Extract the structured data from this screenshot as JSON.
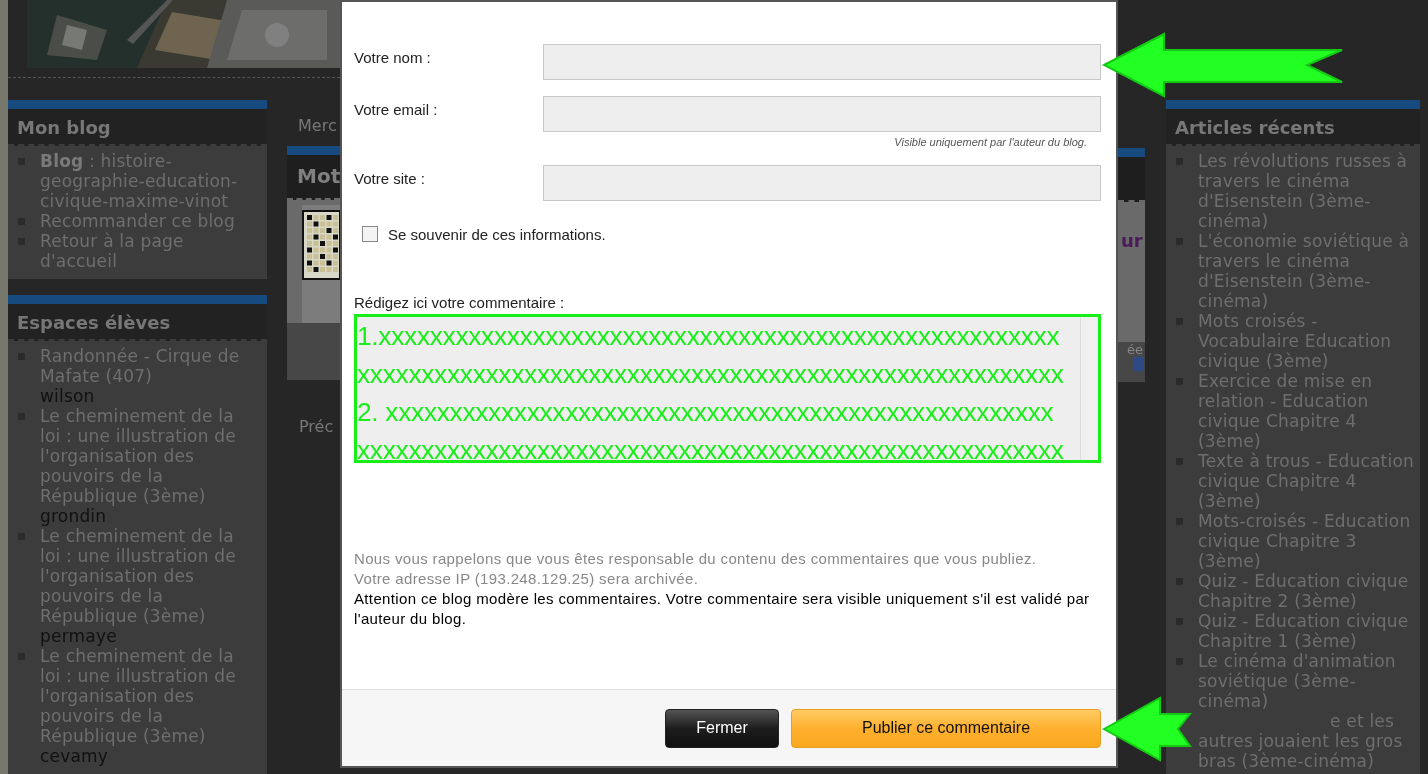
{
  "left_sidebar": [
    {
      "title": "Mon blog",
      "items": [
        {
          "text": "**Blog** : histoire-geographie-education-civique-maxime-vinot"
        },
        {
          "text": "Recommander ce blog"
        },
        {
          "text": "Retour à la page d'accueil"
        }
      ]
    },
    {
      "title": "Espaces élèves",
      "items": [
        {
          "text": "Randonnée - Cirque de Mafate (407)",
          "author": "wilson"
        },
        {
          "text": "Le cheminement de la loi : une illustration de l'organisation des pouvoirs de la République (3ème)",
          "author": "grondin"
        },
        {
          "text": "Le cheminement de la loi : une illustration de l'organisation des pouvoirs de la République (3ème)",
          "author": "permaye"
        },
        {
          "text": "Le cheminement de la loi : une illustration de l'organisation des pouvoirs de la République (3ème)",
          "author": "cevamy"
        }
      ]
    }
  ],
  "middle": {
    "date": "Merc",
    "post_title": "Mot",
    "nav": "Préc",
    "link": "ur",
    "note": "ée"
  },
  "dialog": {
    "fields": [
      {
        "label": "Votre nom :"
      },
      {
        "label": "Votre email :",
        "hint": "Visible uniquement par l'auteur du blog."
      },
      {
        "label": "Votre site :"
      }
    ],
    "remember": {
      "label": "Se souvenir de ces informations.",
      "checked": false
    },
    "comment": {
      "label": "Rédigez ici votre commentaire :",
      "value": "1.xxxxxxxxxxxxxxxxxxxxxxxxxxxxxxxxxxxxxxxxxxxxxxxxxxxxx\nxxxxxxxxxxxxxxxxxxxxxxxxxxxxxxxxxxxxxxxxxxxxxxxxxxxxxxx\n2. xxxxxxxxxxxxxxxxxxxxxxxxxxxxxxxxxxxxxxxxxxxxxxxxxxxx\nxxxxxxxxxxxxxxxxxxxxxxxxxxxxxxxxxxxxxxxxxxxxxxxxxxxxxxx"
    },
    "notices": [
      {
        "kind": "muted",
        "text": "Nous vous rappelons que vous êtes responsable du contenu des commentaires que vous publiez."
      },
      {
        "kind": "muted",
        "text": "Votre adresse IP (193.248.129.25) sera archivée."
      },
      {
        "kind": "strong",
        "text": "Attention ce blog modère les commentaires. Votre commentaire sera visible uniquement s'il est validé par l'auteur du blog."
      }
    ],
    "buttons": [
      {
        "label": "Fermer",
        "kind": "secondary"
      },
      {
        "label": "Publier ce commentaire",
        "kind": "primary"
      }
    ]
  },
  "right_sidebar": {
    "title": "Articles récents",
    "items": [
      {
        "kind": "full",
        "text": "Les révolutions russes à travers le cinéma d'Eisenstein (3ème-cinéma)"
      },
      {
        "kind": "full",
        "text": "L'économie soviétique à travers le cinéma d'Eisenstein (3ème-cinéma)"
      },
      {
        "kind": "full",
        "text": "Mots croisés - Vocabulaire Education civique (3ème)"
      },
      {
        "kind": "full",
        "text": "Exercice de mise en relation - Education civique Chapitre 4 (3ème)"
      },
      {
        "kind": "full",
        "text": "Texte à trous - Education civique Chapitre 4 (3ème)"
      },
      {
        "kind": "full",
        "text": "Mots-croisés - Education civique Chapitre 3 (3ème)"
      },
      {
        "kind": "full",
        "text": "Quiz - Education civique Chapitre 2 (3ème)"
      },
      {
        "kind": "full",
        "text": "Quiz - Education civique Chapitre 1 (3ème)"
      },
      {
        "kind": "full",
        "text": "Le cinéma d'animation soviétique (3ème-cinéma)"
      },
      {
        "kind": "partial",
        "text": "e et les autres jouaient les gros bras (3ème-cinéma)"
      }
    ]
  }
}
